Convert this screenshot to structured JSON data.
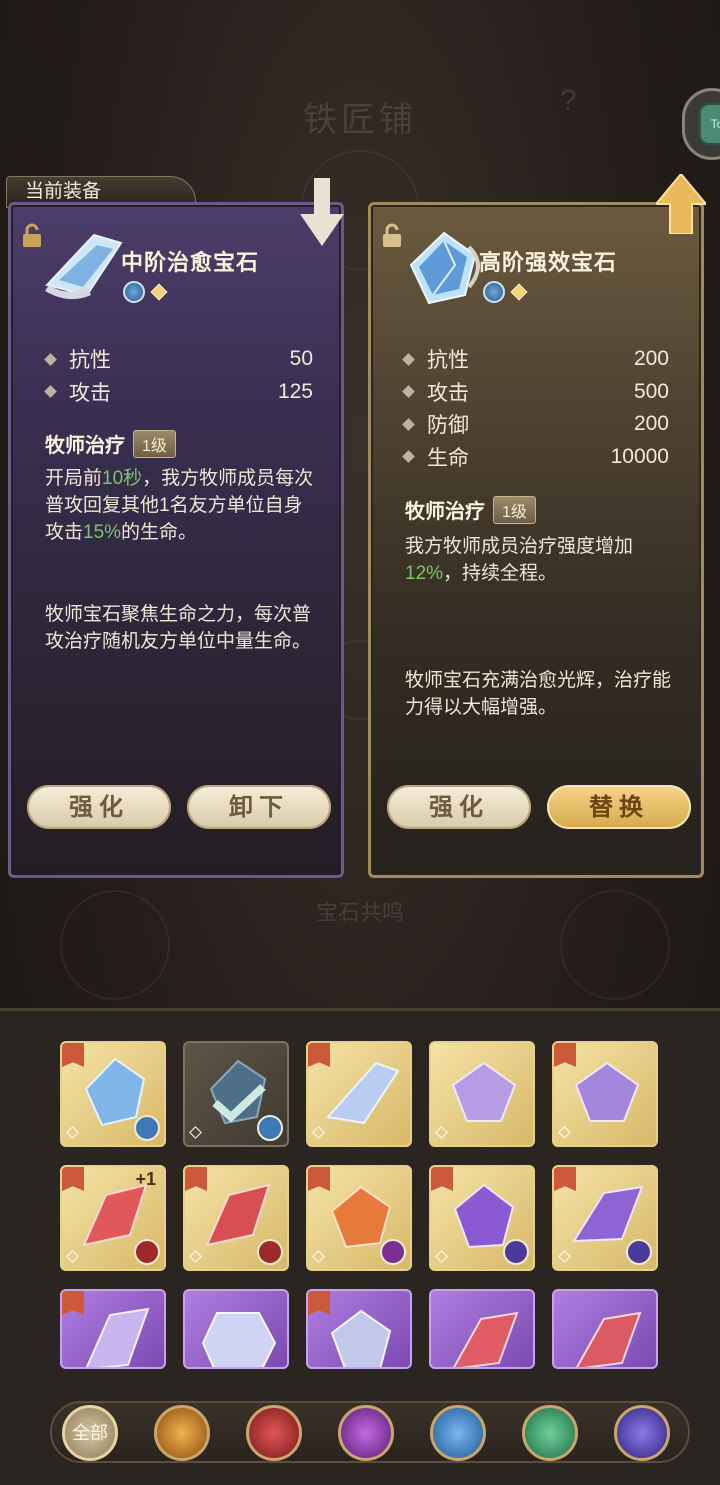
{
  "page": {
    "title": "铁匠铺",
    "help": "?",
    "resonance_label": "宝石共鸣",
    "equip_tag": "当前装备"
  },
  "current": {
    "name": "中阶治愈宝石",
    "stats": [
      {
        "name": "抗性",
        "value": "50"
      },
      {
        "name": "攻击",
        "value": "125"
      }
    ],
    "skill_name": "牧师治疗",
    "skill_level": "1级",
    "skill_desc_parts": [
      "开局前",
      "10秒",
      "，我方牧师成员每次普攻回复其他1名友方单位自身攻击",
      "15%",
      "的生命。"
    ],
    "flavor": "牧师宝石聚焦生命之力，每次普攻治疗随机友方单位中量生命。",
    "btn_upgrade": "强化",
    "btn_unequip": "卸下"
  },
  "candidate": {
    "name": "高阶强效宝石",
    "stats": [
      {
        "name": "抗性",
        "value": "200"
      },
      {
        "name": "攻击",
        "value": "500"
      },
      {
        "name": "防御",
        "value": "200"
      },
      {
        "name": "生命",
        "value": "10000"
      }
    ],
    "skill_name": "牧师治疗",
    "skill_level": "1级",
    "skill_desc_parts": [
      "我方牧师成员治疗强度增加",
      "12%",
      "，持续全程。"
    ],
    "flavor": "牧师宝石充满治愈光辉，治疗能力得以大幅增强。",
    "btn_upgrade": "强化",
    "btn_replace": "替换"
  },
  "inventory": {
    "plus_label": "+1",
    "filter_all": "全部"
  },
  "colors": {
    "highlight": "#7ec36a",
    "gold_slot": "#e6cb80",
    "purple_slot": "#9b68cc"
  }
}
